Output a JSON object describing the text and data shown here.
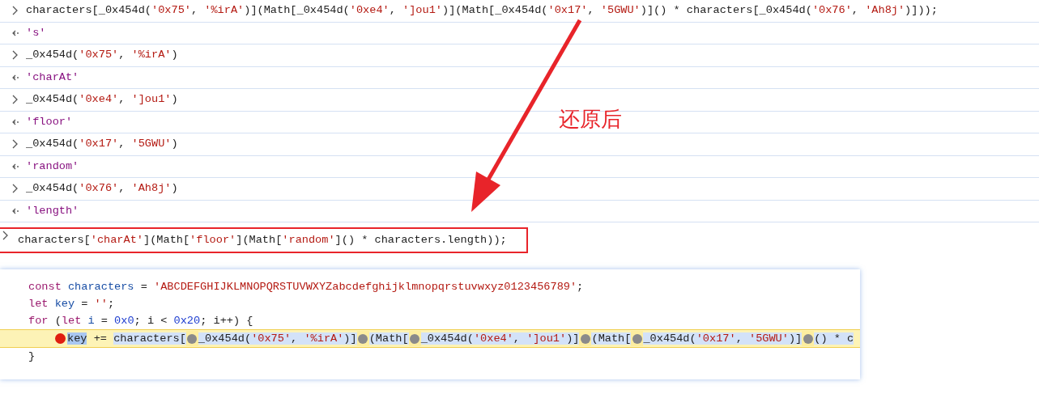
{
  "console": [
    {
      "kind": "input",
      "boxed": false,
      "text": "characters[_0x454d('0x75', '%irA')](Math[_0x454d('0xe4', ']ou1')](Math[_0x454d('0x17', '5GWU')]() * characters[_0x454d('0x76', 'Ah8j')]));"
    },
    {
      "kind": "output",
      "boxed": false,
      "text": "'s'"
    },
    {
      "kind": "input",
      "boxed": false,
      "text": "_0x454d('0x75', '%irA')"
    },
    {
      "kind": "output",
      "boxed": false,
      "text": "'charAt'"
    },
    {
      "kind": "input",
      "boxed": false,
      "text": "_0x454d('0xe4', ']ou1')"
    },
    {
      "kind": "output",
      "boxed": false,
      "text": "'floor'"
    },
    {
      "kind": "input",
      "boxed": false,
      "text": "_0x454d('0x17', '5GWU')"
    },
    {
      "kind": "output",
      "boxed": false,
      "text": "'random'"
    },
    {
      "kind": "input",
      "boxed": false,
      "text": "_0x454d('0x76', 'Ah8j')"
    },
    {
      "kind": "output",
      "boxed": false,
      "text": "'length'"
    },
    {
      "kind": "input",
      "boxed": true,
      "text": "characters['charAt'](Math['floor'](Math['random']() * characters.length));"
    }
  ],
  "annotation": {
    "label": "还原后"
  },
  "editor": {
    "lines": [
      {
        "breakpoint": false,
        "segments": [
          {
            "kind": "keyword",
            "text": "const "
          },
          {
            "kind": "def",
            "text": "characters"
          },
          {
            "kind": "plain",
            "text": " = "
          },
          {
            "kind": "string",
            "text": "'ABCDEFGHIJKLMNOPQRSTUVWXYZabcdefghijklmnopqrstuvwxyz0123456789'"
          },
          {
            "kind": "plain",
            "text": ";"
          }
        ]
      },
      {
        "breakpoint": false,
        "segments": [
          {
            "kind": "keyword",
            "text": "let "
          },
          {
            "kind": "def",
            "text": "key"
          },
          {
            "kind": "plain",
            "text": " = "
          },
          {
            "kind": "string",
            "text": "''"
          },
          {
            "kind": "plain",
            "text": ";"
          }
        ]
      },
      {
        "breakpoint": false,
        "segments": [
          {
            "kind": "keyword",
            "text": "for"
          },
          {
            "kind": "plain",
            "text": " ("
          },
          {
            "kind": "keyword",
            "text": "let "
          },
          {
            "kind": "def",
            "text": "i"
          },
          {
            "kind": "plain",
            "text": " = "
          },
          {
            "kind": "number",
            "text": "0x0"
          },
          {
            "kind": "plain",
            "text": "; i < "
          },
          {
            "kind": "number",
            "text": "0x20"
          },
          {
            "kind": "plain",
            "text": "; i++) {"
          }
        ]
      },
      {
        "breakpoint": true,
        "segments": [
          {
            "kind": "plain",
            "text": "key",
            "selected": true,
            "highlighted": false
          },
          {
            "kind": "plain",
            "text": " += ",
            "selected": false,
            "highlighted": false
          },
          {
            "kind": "plain",
            "text": "characters[",
            "selected": false,
            "highlighted": true
          },
          {
            "kind": "marker"
          },
          {
            "kind": "plain",
            "text": "_0x454d(",
            "selected": false,
            "highlighted": true
          },
          {
            "kind": "string",
            "text": "'0x75'",
            "selected": false,
            "highlighted": true
          },
          {
            "kind": "plain",
            "text": ", ",
            "selected": false,
            "highlighted": true
          },
          {
            "kind": "string",
            "text": "'%irA'",
            "selected": false,
            "highlighted": true
          },
          {
            "kind": "plain",
            "text": ")]",
            "selected": false,
            "highlighted": true
          },
          {
            "kind": "marker"
          },
          {
            "kind": "plain",
            "text": "(Math[",
            "selected": false,
            "highlighted": true
          },
          {
            "kind": "marker"
          },
          {
            "kind": "plain",
            "text": "_0x454d(",
            "selected": false,
            "highlighted": true
          },
          {
            "kind": "string",
            "text": "'0xe4'",
            "selected": false,
            "highlighted": true
          },
          {
            "kind": "plain",
            "text": ", ",
            "selected": false,
            "highlighted": true
          },
          {
            "kind": "string",
            "text": "']ou1'",
            "selected": false,
            "highlighted": true
          },
          {
            "kind": "plain",
            "text": ")]",
            "selected": false,
            "highlighted": true
          },
          {
            "kind": "marker"
          },
          {
            "kind": "plain",
            "text": "(Math[",
            "selected": false,
            "highlighted": true
          },
          {
            "kind": "marker"
          },
          {
            "kind": "plain",
            "text": "_0x454d(",
            "selected": false,
            "highlighted": true
          },
          {
            "kind": "string",
            "text": "'0x17'",
            "selected": false,
            "highlighted": true
          },
          {
            "kind": "plain",
            "text": ", ",
            "selected": false,
            "highlighted": true
          },
          {
            "kind": "string",
            "text": "'5GWU'",
            "selected": false,
            "highlighted": true
          },
          {
            "kind": "plain",
            "text": ")]",
            "selected": false,
            "highlighted": true
          },
          {
            "kind": "marker"
          },
          {
            "kind": "plain",
            "text": "() * c",
            "selected": false,
            "highlighted": true
          }
        ]
      },
      {
        "breakpoint": false,
        "segments": [
          {
            "kind": "plain",
            "text": "}"
          }
        ]
      }
    ]
  }
}
